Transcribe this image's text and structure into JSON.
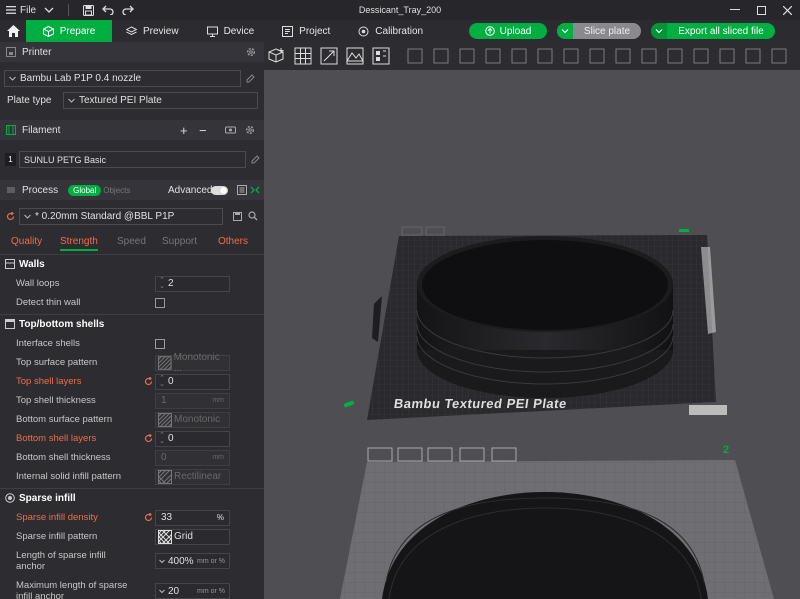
{
  "titlebar": {
    "file_label": "File",
    "title": "Dessicant_Tray_200"
  },
  "tabs": [
    {
      "label": "Prepare"
    },
    {
      "label": "Preview"
    },
    {
      "label": "Device"
    },
    {
      "label": "Project"
    },
    {
      "label": "Calibration"
    }
  ],
  "actions": {
    "upload": "Upload",
    "slice": "Slice plate",
    "export": "Export all sliced file"
  },
  "printer": {
    "header": "Printer",
    "name": "Bambu Lab P1P 0.4 nozzle",
    "plate_type_label": "Plate type",
    "plate_type": "Textured PEI Plate"
  },
  "filament": {
    "header": "Filament",
    "index": "1",
    "name": "SUNLU PETG Basic"
  },
  "process": {
    "header": "Process",
    "global": "Global",
    "objects": "Objects",
    "advanced": "Advanced",
    "preset": "* 0.20mm Standard @BBL P1P",
    "subtabs": [
      "Quality",
      "Strength",
      "Speed",
      "Support",
      "Others"
    ]
  },
  "walls": {
    "title": "Walls",
    "wall_loops_label": "Wall loops",
    "wall_loops": "2",
    "detect_thin_label": "Detect thin wall"
  },
  "topbottom": {
    "title": "Top/bottom shells",
    "interface_label": "Interface shells",
    "top_pattern_label": "Top surface pattern",
    "top_pattern": "Monotonic ...",
    "top_layers_label": "Top shell layers",
    "top_layers": "0",
    "top_thick_label": "Top shell thickness",
    "top_thick": "1",
    "top_thick_unit": "mm",
    "bottom_pattern_label": "Bottom surface pattern",
    "bottom_pattern": "Monotonic",
    "bottom_layers_label": "Bottom shell layers",
    "bottom_layers": "0",
    "bottom_thick_label": "Bottom shell thickness",
    "bottom_thick": "0",
    "bottom_thick_unit": "mm",
    "internal_label": "Internal solid infill pattern",
    "internal": "Rectilinear"
  },
  "sparse": {
    "title": "Sparse infill",
    "density_label": "Sparse infill density",
    "density": "33",
    "density_unit": "%",
    "pattern_label": "Sparse infill pattern",
    "pattern": "Grid",
    "anchor_label_1": "Length of sparse infill",
    "anchor_label_2": "anchor",
    "anchor": "400%",
    "anchor_unit": "mm or %",
    "max_label_1": "Maximum length of sparse",
    "max_label_2": "infill anchor",
    "max": "20",
    "max_unit": "mm or %"
  },
  "plate": {
    "label": "Bambu Textured PEI Plate",
    "number": "2"
  },
  "colors": {
    "accent": "#00ae42",
    "modified": "#f06d48",
    "bed": "#2a2a2e"
  }
}
